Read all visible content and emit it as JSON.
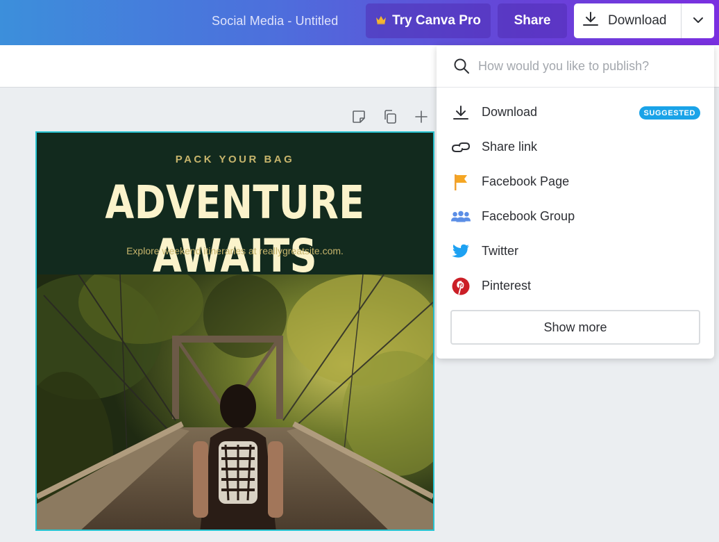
{
  "header": {
    "doc_title": "Social Media - Untitled",
    "try_pro_label": "Try Canva Pro",
    "share_label": "Share",
    "download_label": "Download"
  },
  "page_actions": [
    "note-icon",
    "duplicate-page-icon",
    "add-page-icon"
  ],
  "design": {
    "kicker": "PACK YOUR BAG",
    "headline": "ADVENTURE AWAITS",
    "subtitle": "Explore weekend itineraries at reallygreatsite.com.",
    "accent_color": "#c7b56c",
    "background_color": "#122a1e",
    "selection_color": "#27c4d2"
  },
  "publish_menu": {
    "search_placeholder": "How would you like to publish?",
    "items": [
      {
        "label": "Download",
        "icon": "download-icon",
        "badge": "SUGGESTED"
      },
      {
        "label": "Share link",
        "icon": "link-icon"
      },
      {
        "label": "Facebook Page",
        "icon": "flag-icon"
      },
      {
        "label": "Facebook Group",
        "icon": "group-icon"
      },
      {
        "label": "Twitter",
        "icon": "twitter-icon"
      },
      {
        "label": "Pinterest",
        "icon": "pinterest-icon"
      }
    ],
    "show_more_label": "Show more",
    "badge_color": "#1aa3e8"
  }
}
